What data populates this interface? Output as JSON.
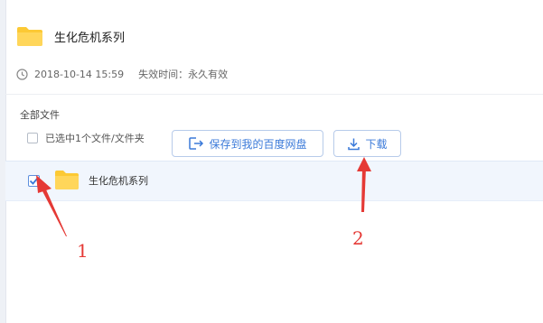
{
  "share": {
    "title": "生化危机系列",
    "date": "2018-10-14 15:59",
    "expiry": "失效时间：永久有效"
  },
  "breadcrumb": "全部文件",
  "toolbar": {
    "selected_text": "已选中1个文件/文件夹",
    "save_label": "保存到我的百度网盘",
    "download_label": "下载"
  },
  "files": [
    {
      "name": "生化危机系列",
      "checked": true
    }
  ],
  "annotations": {
    "one": "1",
    "two": "2"
  },
  "colors": {
    "accent": "#3b7ad9",
    "folder": "#fcc934",
    "annotation": "#e53935"
  },
  "icons": [
    "folder-icon",
    "clock-icon",
    "checkbox-icon",
    "save-to-disk-icon",
    "download-icon",
    "checkmark-icon"
  ]
}
